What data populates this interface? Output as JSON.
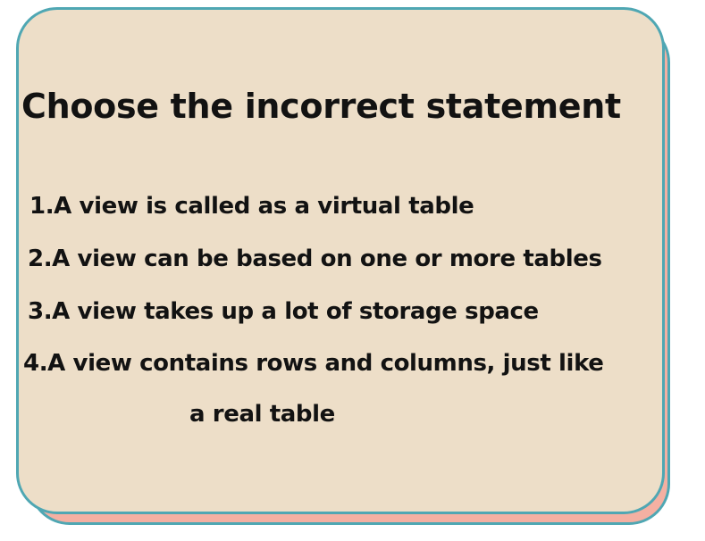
{
  "card": {
    "title": "Choose the incorrect statement",
    "options": [
      {
        "text": "1.A view is called as a virtual table"
      },
      {
        "text": "2.A view can be based on one or more tables"
      },
      {
        "text": "3.A view takes up a lot of storage space"
      },
      {
        "text": "4.A view contains rows and columns, just like",
        "continuation": "a real table"
      }
    ]
  },
  "colors": {
    "card_background": "#eddec8",
    "border": "#4fa7b3",
    "shadow": "#f4b0a2",
    "text": "#121212"
  }
}
